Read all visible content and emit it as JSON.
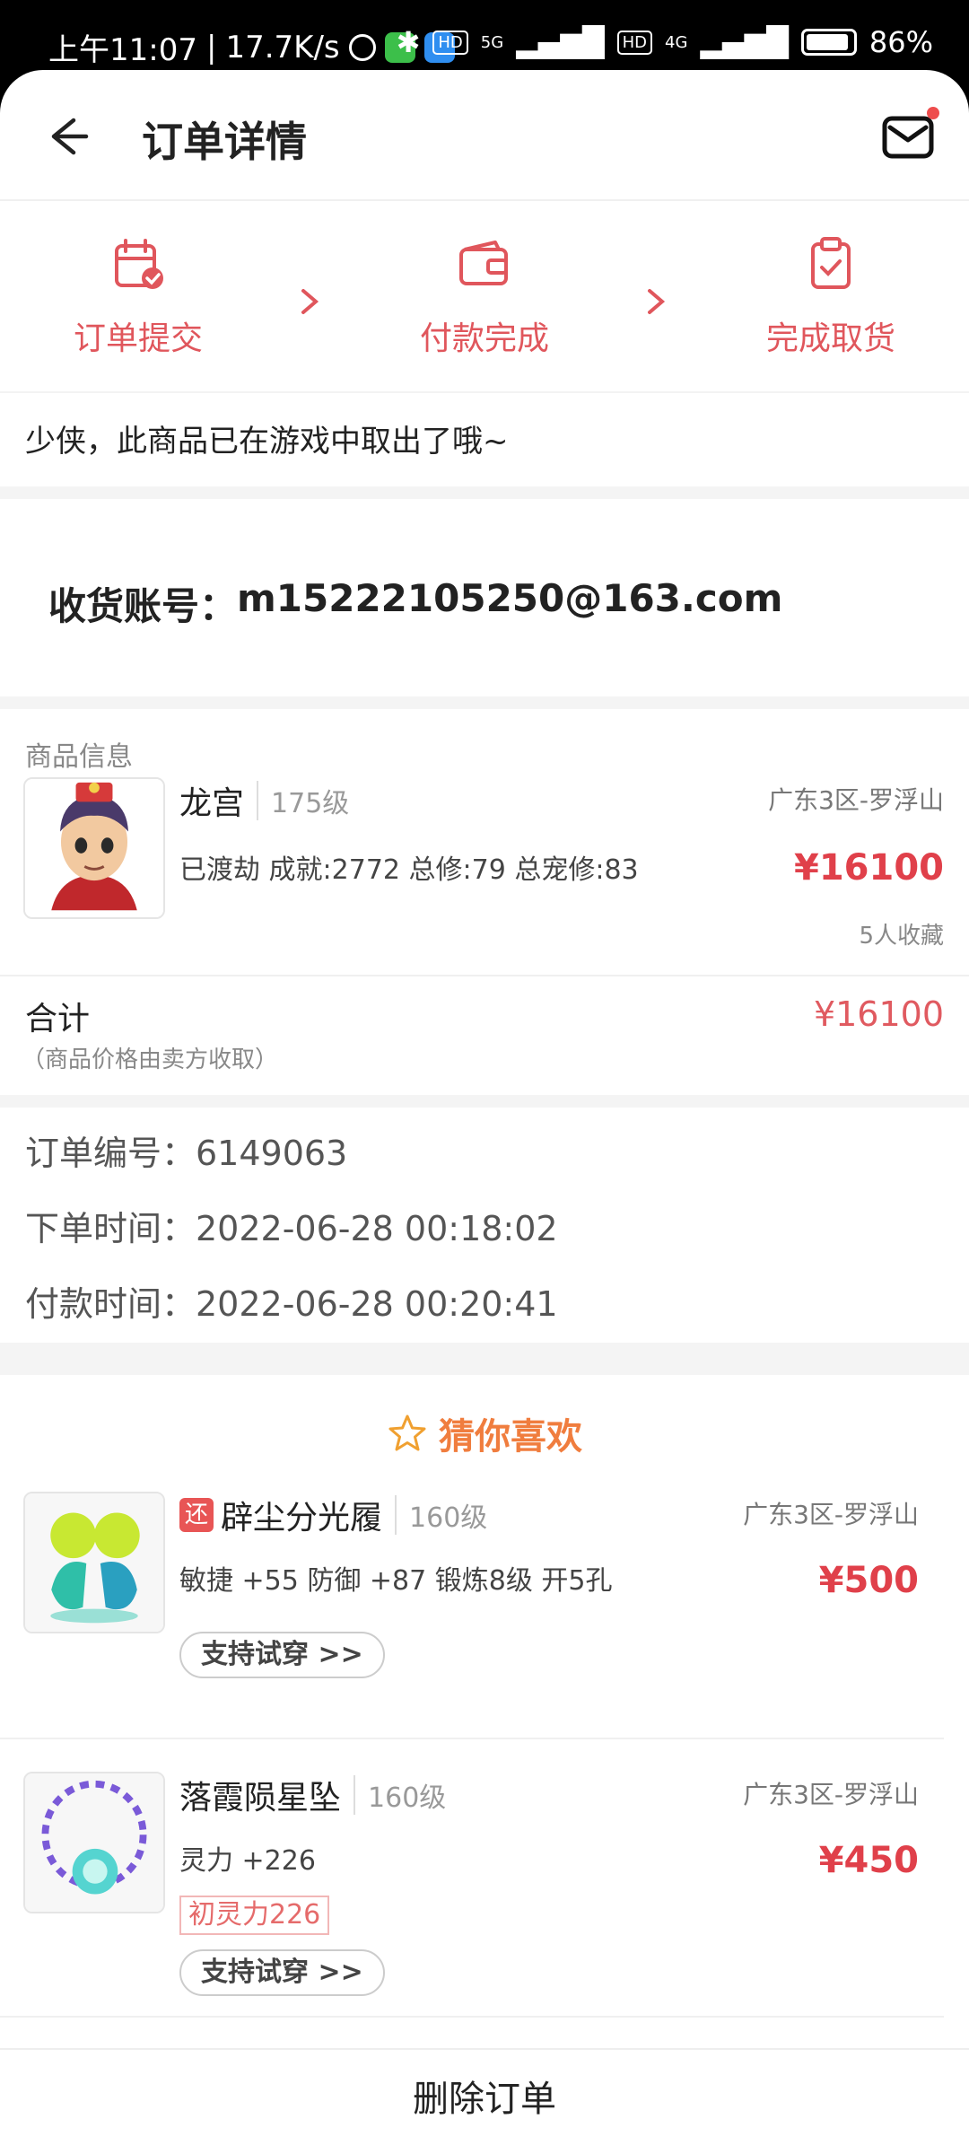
{
  "status_bar": {
    "time": "上午11:07",
    "speed": "17.7K/s",
    "hd1": "HD",
    "net1": "5G",
    "hd2": "HD",
    "net2": "4G",
    "battery": "86%"
  },
  "nav": {
    "title": "订单详情"
  },
  "steps": [
    {
      "label": "订单提交",
      "icon": "calendar-check-icon"
    },
    {
      "label": "付款完成",
      "icon": "wallet-icon"
    },
    {
      "label": "完成取货",
      "icon": "clipboard-check-icon"
    }
  ],
  "notice": "少侠，此商品已在游戏中取出了哦~",
  "receiver": {
    "label": "收货账号：",
    "value": "m15222105250@163.com"
  },
  "product_section_label": "商品信息",
  "product": {
    "name": "龙宫",
    "level": "175级",
    "server": "广东3区-罗浮山",
    "desc": "已渡劫 成就:2772 总修:79 总宠修:83",
    "price": "¥16100",
    "favorites": "5人收藏"
  },
  "total": {
    "label": "合计",
    "note": "（商品价格由卖方收取）",
    "price": "¥16100"
  },
  "order_info": {
    "number": "订单编号：6149063",
    "created": "下单时间：2022-06-28 00:18:02",
    "paid": "付款时间：2022-06-28 00:20:41"
  },
  "recommend": {
    "title": "猜你喜欢",
    "items": [
      {
        "badge": "还",
        "name": "辟尘分光履",
        "level": "160级",
        "server": "广东3区-罗浮山",
        "desc": "敏捷 +55 防御 +87 锻炼8级 开5孔",
        "price": "¥500",
        "try_label": "支持试穿 >>"
      },
      {
        "name": "落霞陨星坠",
        "level": "160级",
        "server": "广东3区-罗浮山",
        "desc": "灵力 +226",
        "attr_tag": "初灵力226",
        "price": "¥450",
        "try_label": "支持试穿 >>"
      }
    ]
  },
  "footer": {
    "delete_label": "删除订单"
  },
  "colors": {
    "accent": "#e0565c",
    "price": "#e0404a",
    "recommend_title": "#f07d3e"
  }
}
